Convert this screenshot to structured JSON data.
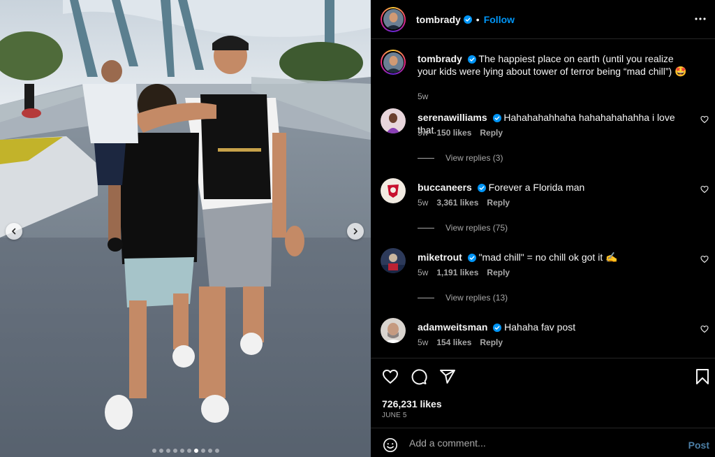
{
  "post": {
    "username": "tombrady",
    "follow_label": "Follow",
    "separator": "•",
    "more_icon": "more-horizontal-icon",
    "carousel": {
      "slides": 10,
      "active_index": 6
    }
  },
  "caption": {
    "username": "tombrady",
    "text": "The happiest place on earth (until you realize your kids were lying about tower of terror being “mad chill”) 🤩",
    "time": "5w"
  },
  "comments": [
    {
      "username": "serenawilliams",
      "text": "Hahahahahhaha hahahahahahha i love that.",
      "time": "5w",
      "likes": "150 likes",
      "reply": "Reply",
      "view_replies": "View replies (3)"
    },
    {
      "username": "buccaneers",
      "text": "Forever a Florida man",
      "time": "5w",
      "likes": "3,361 likes",
      "reply": "Reply",
      "view_replies": "View replies (75)"
    },
    {
      "username": "miketrout",
      "text": "\"mad chill\" = no chill ok got it ✍️",
      "time": "5w",
      "likes": "1,191 likes",
      "reply": "Reply",
      "view_replies": "View replies (13)"
    },
    {
      "username": "adamweitsman",
      "text": "Hahaha fav post",
      "time": "5w",
      "likes": "154 likes",
      "reply": "Reply"
    }
  ],
  "actions": {
    "like_count": "726,231 likes",
    "date": "JUNE 5"
  },
  "composer": {
    "placeholder": "Add a comment...",
    "post_label": "Post"
  },
  "colors": {
    "background": "#000000",
    "accent_blue": "#0095f6",
    "secondary_text": "#a8a8a8",
    "divider": "#262626",
    "verified_badge": "#0095f6"
  }
}
